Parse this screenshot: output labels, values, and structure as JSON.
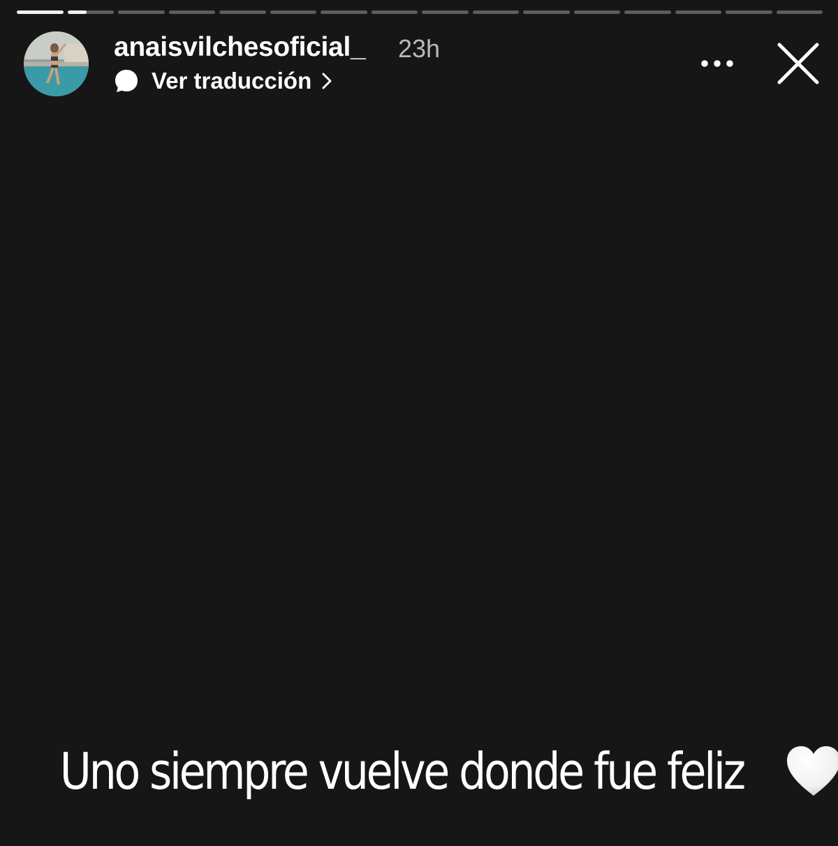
{
  "story": {
    "segments_total": 16,
    "current_segment_index": 1,
    "current_segment_progress": 0.42
  },
  "header": {
    "username": "anaisvilchesoficial_",
    "time_ago": "23h",
    "translate_label": "Ver traducción",
    "avatar_icon": "profile-photo",
    "more_icon": "more-horizontal-icon",
    "close_icon": "close-icon"
  },
  "caption": {
    "text": "Uno siempre vuelve donde fue feliz",
    "emoji": "white-heart"
  },
  "colors": {
    "background": "#161616",
    "text": "#ffffff",
    "muted": "#b9b9b9"
  }
}
